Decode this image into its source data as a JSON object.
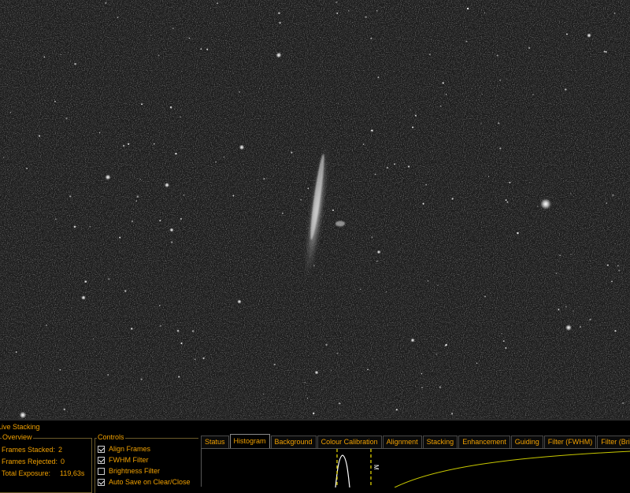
{
  "panel": {
    "title": "Live Stacking"
  },
  "overview": {
    "title": "Overview",
    "rows": [
      {
        "label": "Frames Stacked:",
        "value": "2"
      },
      {
        "label": "Frames Rejected:",
        "value": "0"
      },
      {
        "label": "Total Exposure:",
        "value": "119,63s"
      }
    ]
  },
  "controls": {
    "title": "Controls",
    "items": [
      {
        "label": "Align Frames",
        "checked": true
      },
      {
        "label": "FWHM Filter",
        "checked": true
      },
      {
        "label": "Brightness Filter",
        "checked": false
      },
      {
        "label": "Auto Save on Clear/Close",
        "checked": true
      }
    ]
  },
  "tabs": [
    "Status",
    "Histogram",
    "Background",
    "Colour Calibration",
    "Alignment",
    "Stacking",
    "Enhancement",
    "Guiding",
    "Filter (FWHM)",
    "Filter (Brightness"
  ],
  "active_tab": "Histogram",
  "histogram": {
    "marker_label": "M"
  },
  "colors": {
    "accent": "#f0a000",
    "histogram_curve": "#c8c800",
    "marker": "#f0e000"
  }
}
